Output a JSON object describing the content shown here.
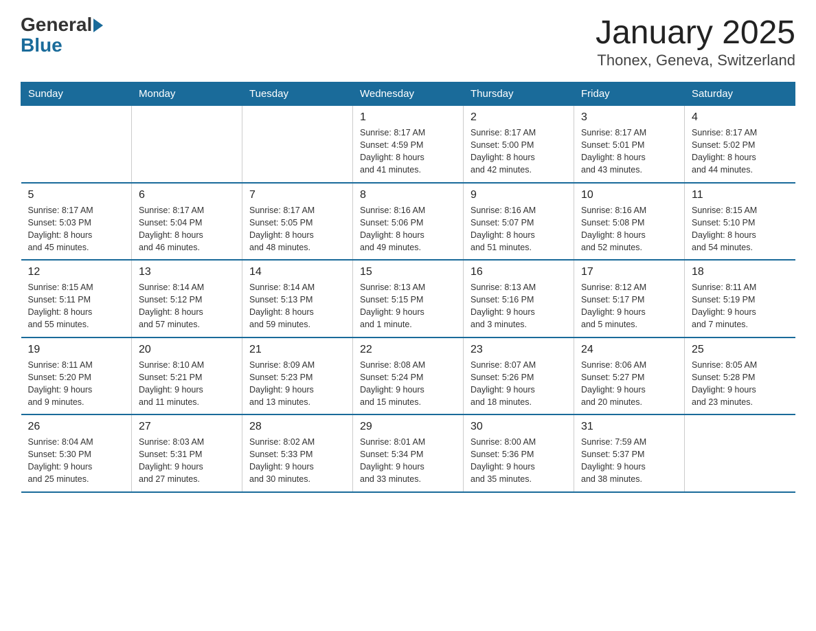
{
  "logo": {
    "general": "General",
    "blue": "Blue"
  },
  "title": "January 2025",
  "subtitle": "Thonex, Geneva, Switzerland",
  "days_of_week": [
    "Sunday",
    "Monday",
    "Tuesday",
    "Wednesday",
    "Thursday",
    "Friday",
    "Saturday"
  ],
  "weeks": [
    [
      {
        "day": "",
        "info": ""
      },
      {
        "day": "",
        "info": ""
      },
      {
        "day": "",
        "info": ""
      },
      {
        "day": "1",
        "info": "Sunrise: 8:17 AM\nSunset: 4:59 PM\nDaylight: 8 hours\nand 41 minutes."
      },
      {
        "day": "2",
        "info": "Sunrise: 8:17 AM\nSunset: 5:00 PM\nDaylight: 8 hours\nand 42 minutes."
      },
      {
        "day": "3",
        "info": "Sunrise: 8:17 AM\nSunset: 5:01 PM\nDaylight: 8 hours\nand 43 minutes."
      },
      {
        "day": "4",
        "info": "Sunrise: 8:17 AM\nSunset: 5:02 PM\nDaylight: 8 hours\nand 44 minutes."
      }
    ],
    [
      {
        "day": "5",
        "info": "Sunrise: 8:17 AM\nSunset: 5:03 PM\nDaylight: 8 hours\nand 45 minutes."
      },
      {
        "day": "6",
        "info": "Sunrise: 8:17 AM\nSunset: 5:04 PM\nDaylight: 8 hours\nand 46 minutes."
      },
      {
        "day": "7",
        "info": "Sunrise: 8:17 AM\nSunset: 5:05 PM\nDaylight: 8 hours\nand 48 minutes."
      },
      {
        "day": "8",
        "info": "Sunrise: 8:16 AM\nSunset: 5:06 PM\nDaylight: 8 hours\nand 49 minutes."
      },
      {
        "day": "9",
        "info": "Sunrise: 8:16 AM\nSunset: 5:07 PM\nDaylight: 8 hours\nand 51 minutes."
      },
      {
        "day": "10",
        "info": "Sunrise: 8:16 AM\nSunset: 5:08 PM\nDaylight: 8 hours\nand 52 minutes."
      },
      {
        "day": "11",
        "info": "Sunrise: 8:15 AM\nSunset: 5:10 PM\nDaylight: 8 hours\nand 54 minutes."
      }
    ],
    [
      {
        "day": "12",
        "info": "Sunrise: 8:15 AM\nSunset: 5:11 PM\nDaylight: 8 hours\nand 55 minutes."
      },
      {
        "day": "13",
        "info": "Sunrise: 8:14 AM\nSunset: 5:12 PM\nDaylight: 8 hours\nand 57 minutes."
      },
      {
        "day": "14",
        "info": "Sunrise: 8:14 AM\nSunset: 5:13 PM\nDaylight: 8 hours\nand 59 minutes."
      },
      {
        "day": "15",
        "info": "Sunrise: 8:13 AM\nSunset: 5:15 PM\nDaylight: 9 hours\nand 1 minute."
      },
      {
        "day": "16",
        "info": "Sunrise: 8:13 AM\nSunset: 5:16 PM\nDaylight: 9 hours\nand 3 minutes."
      },
      {
        "day": "17",
        "info": "Sunrise: 8:12 AM\nSunset: 5:17 PM\nDaylight: 9 hours\nand 5 minutes."
      },
      {
        "day": "18",
        "info": "Sunrise: 8:11 AM\nSunset: 5:19 PM\nDaylight: 9 hours\nand 7 minutes."
      }
    ],
    [
      {
        "day": "19",
        "info": "Sunrise: 8:11 AM\nSunset: 5:20 PM\nDaylight: 9 hours\nand 9 minutes."
      },
      {
        "day": "20",
        "info": "Sunrise: 8:10 AM\nSunset: 5:21 PM\nDaylight: 9 hours\nand 11 minutes."
      },
      {
        "day": "21",
        "info": "Sunrise: 8:09 AM\nSunset: 5:23 PM\nDaylight: 9 hours\nand 13 minutes."
      },
      {
        "day": "22",
        "info": "Sunrise: 8:08 AM\nSunset: 5:24 PM\nDaylight: 9 hours\nand 15 minutes."
      },
      {
        "day": "23",
        "info": "Sunrise: 8:07 AM\nSunset: 5:26 PM\nDaylight: 9 hours\nand 18 minutes."
      },
      {
        "day": "24",
        "info": "Sunrise: 8:06 AM\nSunset: 5:27 PM\nDaylight: 9 hours\nand 20 minutes."
      },
      {
        "day": "25",
        "info": "Sunrise: 8:05 AM\nSunset: 5:28 PM\nDaylight: 9 hours\nand 23 minutes."
      }
    ],
    [
      {
        "day": "26",
        "info": "Sunrise: 8:04 AM\nSunset: 5:30 PM\nDaylight: 9 hours\nand 25 minutes."
      },
      {
        "day": "27",
        "info": "Sunrise: 8:03 AM\nSunset: 5:31 PM\nDaylight: 9 hours\nand 27 minutes."
      },
      {
        "day": "28",
        "info": "Sunrise: 8:02 AM\nSunset: 5:33 PM\nDaylight: 9 hours\nand 30 minutes."
      },
      {
        "day": "29",
        "info": "Sunrise: 8:01 AM\nSunset: 5:34 PM\nDaylight: 9 hours\nand 33 minutes."
      },
      {
        "day": "30",
        "info": "Sunrise: 8:00 AM\nSunset: 5:36 PM\nDaylight: 9 hours\nand 35 minutes."
      },
      {
        "day": "31",
        "info": "Sunrise: 7:59 AM\nSunset: 5:37 PM\nDaylight: 9 hours\nand 38 minutes."
      },
      {
        "day": "",
        "info": ""
      }
    ]
  ]
}
